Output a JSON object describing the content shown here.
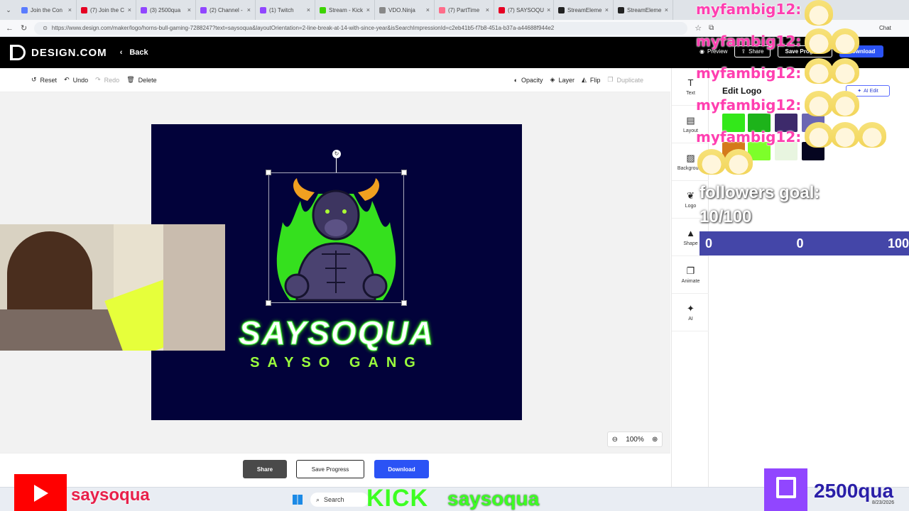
{
  "browser": {
    "tabs": [
      {
        "label": "Join the Con",
        "icon": "reddit-icon",
        "color": "#5a7cff"
      },
      {
        "label": "(7) Join the C",
        "icon": "youtube-icon",
        "color": "#e60023"
      },
      {
        "label": "(3) 2500qua",
        "icon": "twitch-icon",
        "color": "#9146ff"
      },
      {
        "label": "(2) Channel -",
        "icon": "twitch-icon",
        "color": "#9146ff"
      },
      {
        "label": "(1) Twitch",
        "icon": "twitch-icon",
        "color": "#9146ff"
      },
      {
        "label": "Stream - Kick",
        "icon": "kick-icon",
        "color": "#3dd400"
      },
      {
        "label": "VDO.Ninja",
        "icon": "vdo-icon",
        "color": "#888888"
      },
      {
        "label": "(7) PartTime",
        "icon": "tab-icon",
        "color": "#ff6d8a"
      },
      {
        "label": "(7) SAYSOQU",
        "icon": "youtube-icon",
        "color": "#e60023"
      },
      {
        "label": "StreamEleme",
        "icon": "se-icon",
        "color": "#222222"
      },
      {
        "label": "StreamEleme",
        "icon": "se-icon",
        "color": "#222222"
      }
    ],
    "url": "https://www.design.com/maker/logo/horns-bull-gaming-7288247?text=saysoqua&layoutOrientation=2-line-break-at-14-with-since-year&isSearchImpressionId=c2eb41b5-f7b8-451a-b37a-a44688f944e2",
    "chrome_label": "Chat"
  },
  "app": {
    "logo_text": "DESIGN.COM",
    "back_label": "Back",
    "preview_label": "Preview",
    "share_label": "Share",
    "save_label": "Save Progress",
    "download_label": "Download"
  },
  "toolbar": {
    "reset": "Reset",
    "undo": "Undo",
    "redo": "Redo",
    "delete": "Delete",
    "opacity": "Opacity",
    "layer": "Layer",
    "flip": "Flip",
    "duplicate": "Duplicate"
  },
  "canvas": {
    "brand_name": "SAYSOQUA",
    "slogan": "SAYSO GANG",
    "background": "#02023a",
    "accent": "#3df000"
  },
  "zoom": {
    "value": "100%"
  },
  "bottom": {
    "share": "Share",
    "save": "Save Progress",
    "download": "Download"
  },
  "rail": [
    {
      "label": "Text",
      "icon": "text-icon"
    },
    {
      "label": "Layout",
      "icon": "layout-icon"
    },
    {
      "label": "Background",
      "icon": "background-icon"
    },
    {
      "label": "Logo",
      "icon": "logo-icon"
    },
    {
      "label": "Shape",
      "icon": "shape-icon"
    },
    {
      "label": "Animate",
      "icon": "animate-icon"
    },
    {
      "label": "AI",
      "icon": "ai-sparkle-icon"
    }
  ],
  "panel": {
    "title": "Edit Logo",
    "ai_edit": "AI Edit",
    "swatches": [
      "#33e81a",
      "#1db31a",
      "#3d2a6b",
      "#6b66b3",
      "#d47a1a",
      "#7dff2a",
      "#e8f5e0",
      "#050520"
    ]
  },
  "overlay": {
    "chat_lines": [
      "myfambig12:",
      "myfambig12:",
      "myfambig12:",
      "myfambig12:",
      "myfambig12:"
    ],
    "goal_title": "followers goal:",
    "goal_count": "10/100",
    "goal_min": "0",
    "goal_mid": "0",
    "goal_max": "100",
    "youtube_name": "saysoqua",
    "kick_label": "KICK",
    "kick_name": "saysoqua",
    "twitch_name": "2500qua"
  },
  "taskbar": {
    "search": "Search",
    "date": "8/23/2026"
  }
}
